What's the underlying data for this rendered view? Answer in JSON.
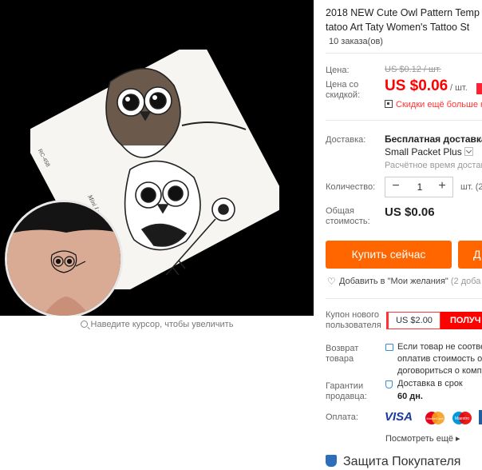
{
  "gallery": {
    "stencil_code": "RC-458",
    "stencil_signature": "Mini Lucky",
    "zoom_hint": "Наведите курсор, чтобы увеличить"
  },
  "product": {
    "title_line1": "2018 NEW Cute Owl Pattern Temp",
    "title_line2": "tatoo Art Taty Women's Tattoo St",
    "orders": "10 заказа(ов)"
  },
  "price": {
    "price_label": "Цена:",
    "old_price": "US $0.12 / шт.",
    "discount_label": "Цена со скидкой:",
    "new_price": "US $0.06",
    "unit": "/ шт.",
    "coupon_line": "Скидки ещё больше н"
  },
  "shipping": {
    "label": "Доставка:",
    "name": "Бесплатная доставка в",
    "method": "Small Packet Plus",
    "time": "Расчётное время доставк"
  },
  "quantity": {
    "label": "Количество:",
    "minus": "−",
    "value": "1",
    "plus": "+",
    "unit": "шт. (2"
  },
  "total": {
    "label": "Общая стоимость:",
    "value": "US $0.06"
  },
  "actions": {
    "buy_now": "Купить сейчас",
    "add_to_cart": "Д",
    "wishlist": "Добавить в \"Мои желания\"",
    "wishlist_count": "(2 доба"
  },
  "coupon": {
    "label": "Купон нового пользователя",
    "value": "US $2.00",
    "button": "ПОЛУЧ"
  },
  "returns": {
    "label": "Возврат товара",
    "text_lines": [
      "Если товар не соотве",
      "оплатив стоимость о",
      "договориться о комп"
    ]
  },
  "guarantee": {
    "label": "Гарантии продавца:",
    "line1": "Доставка в срок",
    "line2": "60 дн."
  },
  "payment": {
    "label": "Оплата:",
    "visa": "VISA",
    "mastercard": "MasterCard",
    "maestro": "Maestro",
    "more": "Посмотреть ещё"
  },
  "protection": {
    "title": "Защита Покупателя"
  },
  "colors": {
    "accent_orange": "#ff6600",
    "price_red": "#ff0000",
    "icon_blue": "#3a8ed8"
  }
}
